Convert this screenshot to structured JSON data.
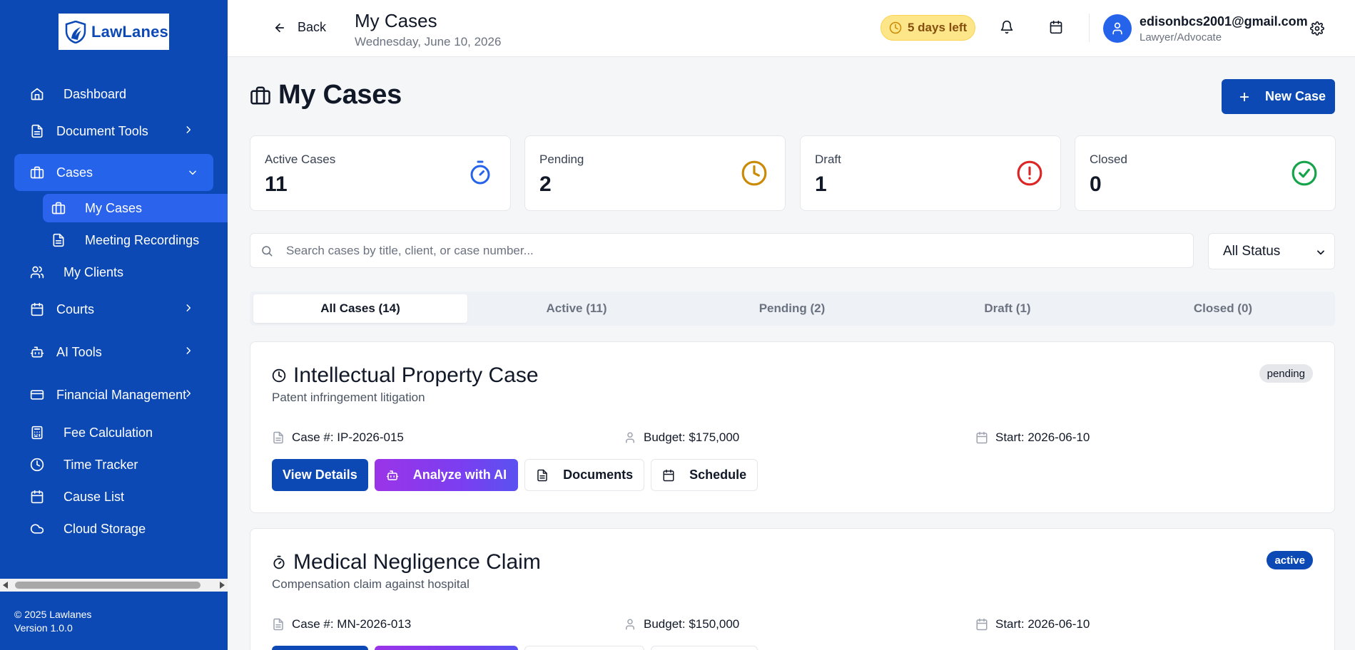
{
  "brand": {
    "name": "LawLanes"
  },
  "sidebar": {
    "items": [
      {
        "label": "Dashboard",
        "icon": "home-icon"
      },
      {
        "label": "Document Tools",
        "icon": "file-icon"
      },
      {
        "label": "Cases",
        "icon": "briefcase-icon"
      },
      {
        "label": "My Cases",
        "icon": "briefcase-icon"
      },
      {
        "label": "Meeting Recordings",
        "icon": "file-icon"
      },
      {
        "label": "My Clients",
        "icon": "users-icon"
      },
      {
        "label": "Courts",
        "icon": "calendar-icon"
      },
      {
        "label": "AI Tools",
        "icon": "bot-icon"
      },
      {
        "label": "Financial Management",
        "icon": "credit-card-icon"
      },
      {
        "label": "Fee Calculation",
        "icon": "calculator-icon"
      },
      {
        "label": "Time Tracker",
        "icon": "clock-icon"
      },
      {
        "label": "Cause List",
        "icon": "calendar-icon"
      },
      {
        "label": "Cloud Storage",
        "icon": "cloud-icon"
      }
    ],
    "footer_copyright": "© 2025 Lawlanes",
    "footer_version": "Version 1.0.0"
  },
  "header": {
    "back_label": "Back",
    "title": "My Cases",
    "date": "Wednesday, June 10, 2026",
    "trial_label": "5 days left",
    "user_email": "edisonbcs2001@gmail.com",
    "user_role": "Lawyer/Advocate"
  },
  "main": {
    "title": "My Cases",
    "new_case_label": "New Case",
    "stats": [
      {
        "label": "Active Cases",
        "value": "11",
        "color": "#2563eb"
      },
      {
        "label": "Pending",
        "value": "2",
        "color": "#ca8a04"
      },
      {
        "label": "Draft",
        "value": "1",
        "color": "#dc2626"
      },
      {
        "label": "Closed",
        "value": "0",
        "color": "#16a34a"
      }
    ],
    "search_placeholder": "Search cases by title, client, or case number...",
    "status_filter": "All Status",
    "tabs": [
      {
        "label": "All Cases (14)"
      },
      {
        "label": "Active (11)"
      },
      {
        "label": "Pending (2)"
      },
      {
        "label": "Draft (1)"
      },
      {
        "label": "Closed (0)"
      }
    ],
    "cases": [
      {
        "title": "Intellectual Property Case",
        "description": "Patent infringement litigation",
        "status": "pending",
        "case_number": "Case #: IP-2026-015",
        "budget": "Budget: $175,000",
        "start": "Start: 2026-06-10"
      },
      {
        "title": "Medical Negligence Claim",
        "description": "Compensation claim against hospital",
        "status": "active",
        "case_number": "Case #: MN-2026-013",
        "budget": "Budget: $150,000",
        "start": "Start: 2026-06-10"
      }
    ],
    "actions": {
      "view_details": "View Details",
      "analyze_ai": "Analyze with AI",
      "documents": "Documents",
      "schedule": "Schedule"
    }
  },
  "colors": {
    "sidebar_bg": "#0c49b5",
    "accent": "#2563eb",
    "primary_button": "#0c49b5",
    "ai_gradient_start": "#9b34e8",
    "ai_gradient_end": "#5a52f0"
  }
}
